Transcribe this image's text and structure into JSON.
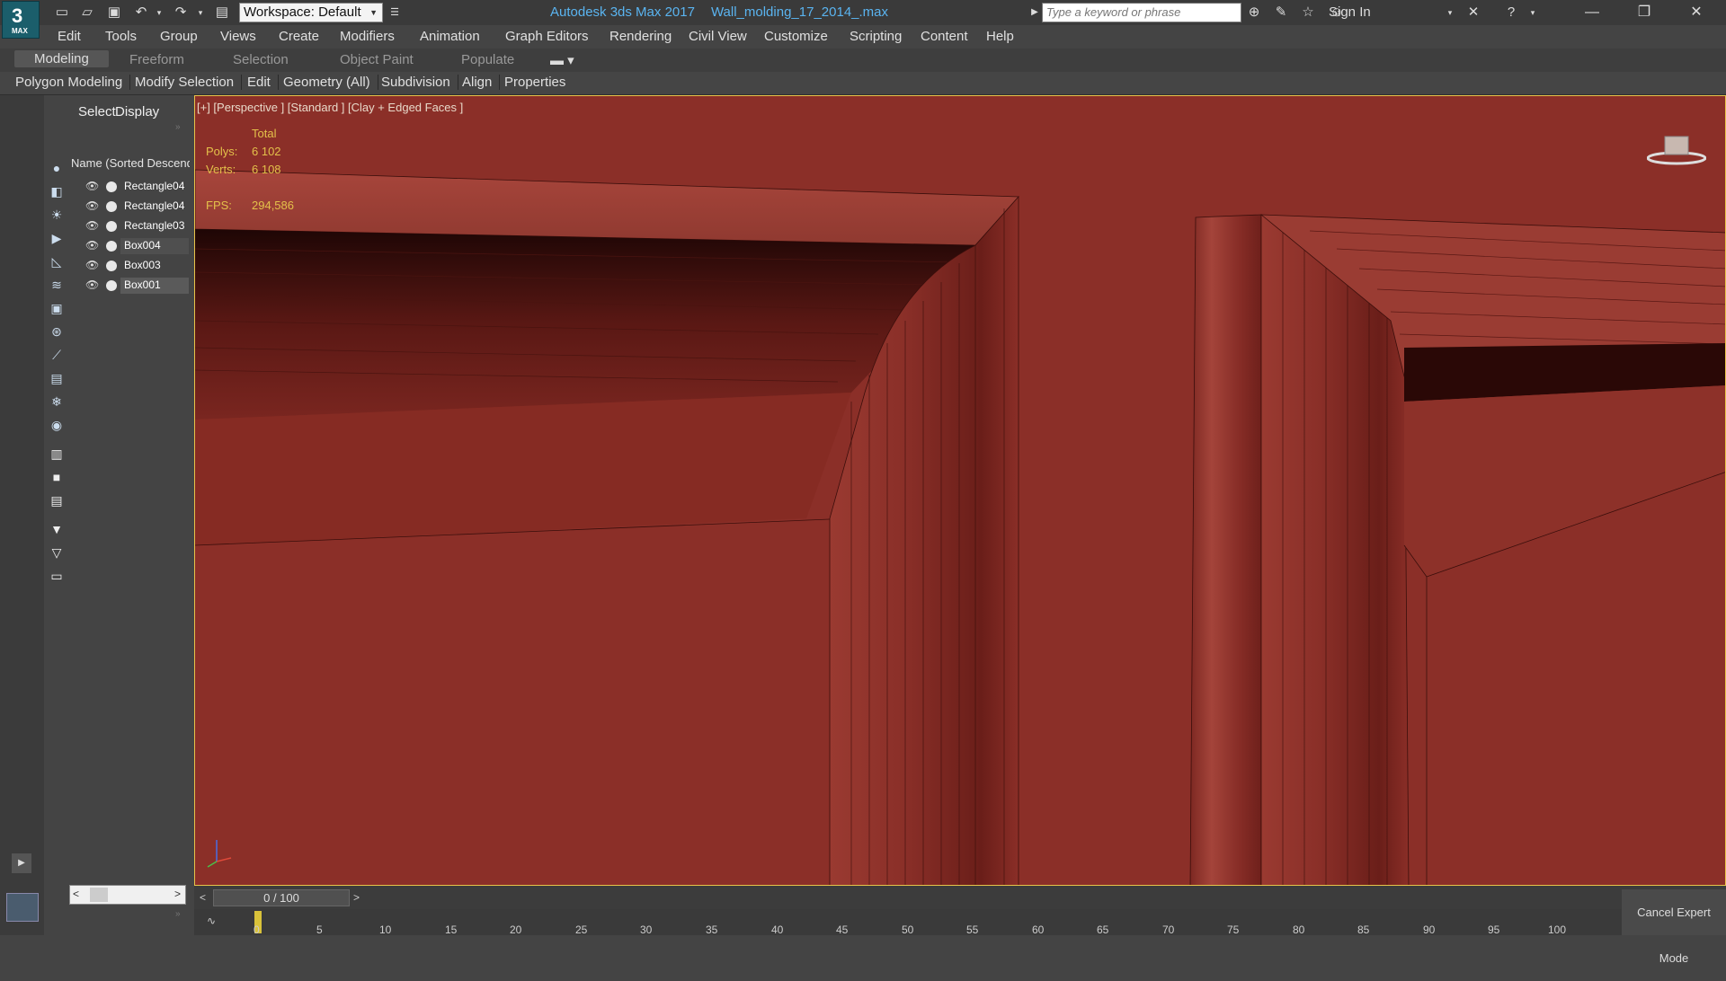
{
  "app": {
    "logo_number": "3",
    "logo_text": "MAX",
    "product": "Autodesk 3ds Max 2017",
    "file": "Wall_molding_17_2014_.max",
    "workspace": "Workspace: Default",
    "search_placeholder": "Type a keyword or phrase",
    "sign_in": "Sign In"
  },
  "menu": [
    "Edit",
    "Tools",
    "Group",
    "Views",
    "Create",
    "Modifiers",
    "Animation",
    "Graph Editors",
    "Rendering",
    "Civil View",
    "Customize",
    "Scripting",
    "Content",
    "Help"
  ],
  "ribbon_tabs": [
    "Modeling",
    "Freeform",
    "Selection",
    "Object Paint",
    "Populate"
  ],
  "ribbon_panels": [
    "Polygon Modeling",
    "Modify Selection",
    "Edit",
    "Geometry (All)",
    "Subdivision",
    "Align",
    "Properties"
  ],
  "explorer": {
    "tabs": [
      "Select",
      "Display"
    ],
    "column_header": "Name (Sorted Descending)",
    "items": [
      {
        "name": "Rectangle04",
        "state": "normal"
      },
      {
        "name": "Rectangle04",
        "state": "normal"
      },
      {
        "name": "Rectangle03",
        "state": "normal"
      },
      {
        "name": "Box004",
        "state": "highlight"
      },
      {
        "name": "Box003",
        "state": "normal"
      },
      {
        "name": "Box001",
        "state": "selected"
      }
    ]
  },
  "viewport": {
    "label": "[+] [Perspective ] [Standard ] [Clay + Edged Faces ]",
    "stats_header": "Total",
    "polys_label": "Polys:",
    "polys_value": "6 102",
    "verts_label": "Verts:",
    "verts_value": "6 108",
    "fps_label": "FPS:",
    "fps_value": "294,586",
    "background_color": "#8a2e27"
  },
  "timeline": {
    "frame": "0 / 100",
    "ticks": [
      "0",
      "5",
      "10",
      "15",
      "20",
      "25",
      "30",
      "35",
      "40",
      "45",
      "50",
      "55",
      "60",
      "65",
      "70",
      "75",
      "80",
      "85",
      "90",
      "95",
      "100"
    ]
  },
  "cancel_expert_mode": "Cancel Expert Mode"
}
